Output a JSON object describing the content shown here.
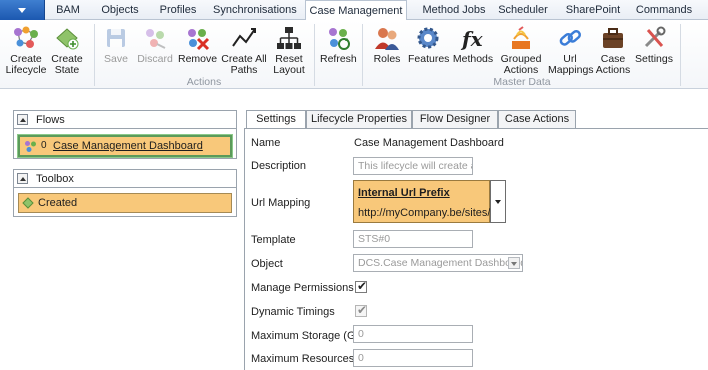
{
  "menu_tabs": [
    "BAM",
    "Objects",
    "Profiles",
    "Synchronisations",
    "Case Management",
    "Method Jobs",
    "Scheduler",
    "SharePoint",
    "Commands"
  ],
  "ribbon": {
    "create_lifecycle": "Create Lifecycle",
    "create_state": "Create State",
    "save": "Save",
    "discard": "Discard",
    "remove": "Remove",
    "create_all_paths": "Create All Paths",
    "reset_layout": "Reset Layout",
    "refresh": "Refresh",
    "roles": "Roles",
    "features": "Features",
    "methods": "Methods",
    "grouped_actions": "Grouped Actions",
    "url_mappings": "Url Mappings",
    "case_actions": "Case Actions",
    "settings": "Settings",
    "group_actions": "Actions",
    "group_master_data": "Master Data"
  },
  "flows": {
    "title": "Flows",
    "item_number": "0",
    "item_label": "Case Management Dashboard"
  },
  "toolbox": {
    "title": "Toolbox",
    "item_label": "Created"
  },
  "detail_tabs": [
    "Settings",
    "Lifecycle Properties",
    "Flow Designer",
    "Case Actions"
  ],
  "form": {
    "name_label": "Name",
    "name_value": "Case Management Dashboard",
    "description_label": "Description",
    "description_value": "This lifecycle will create a sh",
    "url_mapping_label": "Url Mapping",
    "url_title": "Internal Url Prefix",
    "url_value": "http://myCompany.be/sites/",
    "template_label": "Template",
    "template_value": "STS#0",
    "object_label": "Object",
    "object_value": "DCS.Case Management Dashboard",
    "manage_permissions_label": "Manage Permissions",
    "manage_permissions_checked": "✔",
    "dynamic_timings_label": "Dynamic Timings",
    "dynamic_timings_checked": "✔",
    "max_storage_label": "Maximum Storage (Gb)",
    "max_storage_value": "0",
    "max_resources_label": "Maximum Resources",
    "max_resources_value": "0"
  }
}
